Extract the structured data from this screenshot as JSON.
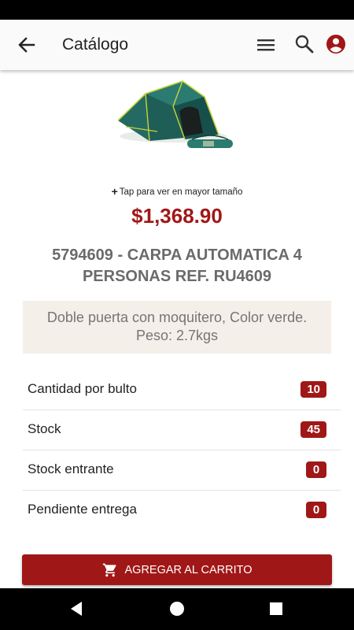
{
  "appbar": {
    "title": "Catálogo",
    "icons": {
      "back": "arrow-back-icon",
      "menu": "menu-icon",
      "search": "search-icon",
      "account": "account-circle-icon"
    }
  },
  "product": {
    "image": "tent-product-image",
    "tap_hint": "Tap para ver en mayor tamaño",
    "price": "$1,368.90",
    "title": "5794609 - CARPA AUTOMATICA 4 PERSONAS REF. RU4609",
    "description_lines": [
      "Doble puerta con moquitero, Color verde.",
      "Peso: 2.7kgs"
    ]
  },
  "info": [
    {
      "label": "Cantidad por bulto",
      "value": "10"
    },
    {
      "label": "Stock",
      "value": "45"
    },
    {
      "label": "Stock entrante",
      "value": "0"
    },
    {
      "label": "Pendiente entrega",
      "value": "0"
    }
  ],
  "actions": {
    "add_to_cart": "AGREGAR AL CARRITO",
    "cart_icon": "cart-icon"
  },
  "navbar": {
    "icons": [
      "back-triangle-icon",
      "home-circle-icon",
      "recents-square-icon"
    ]
  },
  "colors": {
    "accent": "#a01717",
    "desc_bg": "#f5efea",
    "appbar_bg": "#fafafa"
  }
}
